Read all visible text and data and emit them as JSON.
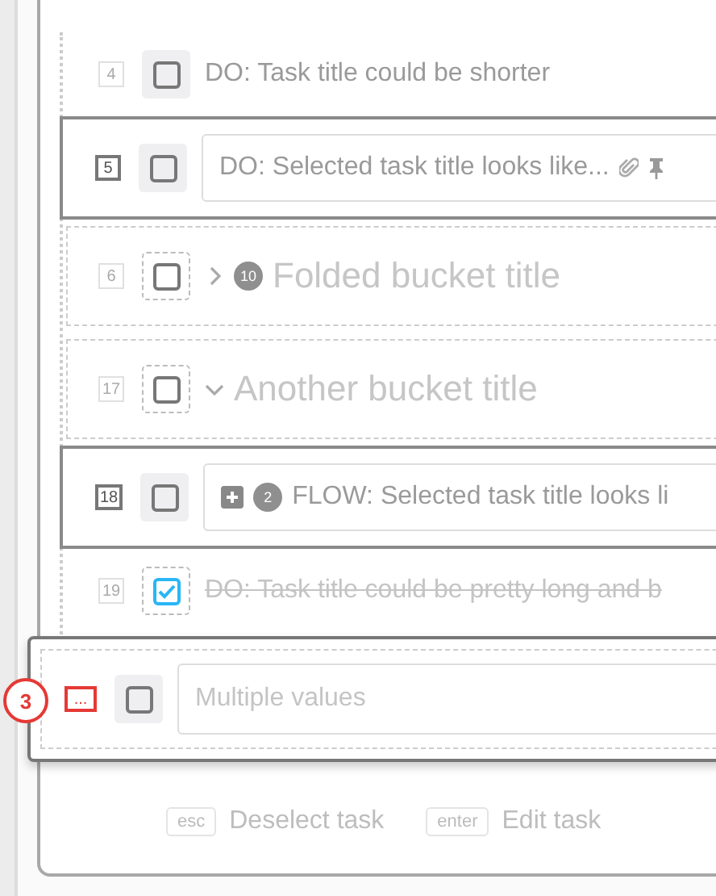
{
  "rows": [
    {
      "kind": "task",
      "index": "4",
      "checked": false,
      "selected": false,
      "title": "DO: Task title could be shorter",
      "attachment": false,
      "pinned": false,
      "subtasks": false
    },
    {
      "kind": "task",
      "index": "5",
      "checked": false,
      "selected": true,
      "title": "DO: Selected task title looks like...",
      "attachment": true,
      "pinned": true,
      "subtasks": false
    },
    {
      "kind": "bucket",
      "index": "6",
      "checked": false,
      "expanded": false,
      "count": "10",
      "title": "Folded bucket title"
    },
    {
      "kind": "bucket",
      "index": "17",
      "checked": false,
      "expanded": true,
      "title": "Another bucket title"
    },
    {
      "kind": "task",
      "index": "18",
      "checked": false,
      "selected": true,
      "title": "FLOW: Selected task title looks li",
      "count": "2",
      "attachment": false,
      "pinned": false,
      "subtasks": true
    },
    {
      "kind": "task",
      "index": "19",
      "checked": true,
      "selected": false,
      "title": "DO: Task title could be pretty long and b",
      "attachment": false,
      "pinned": false,
      "subtasks": false
    },
    {
      "kind": "multi",
      "badge": "3",
      "index": "...",
      "checked": false,
      "placeholder": "Multiple values"
    }
  ],
  "shortcuts": [
    {
      "key": "esc",
      "label": "Deselect task"
    },
    {
      "key": "enter",
      "label": "Edit task"
    }
  ]
}
